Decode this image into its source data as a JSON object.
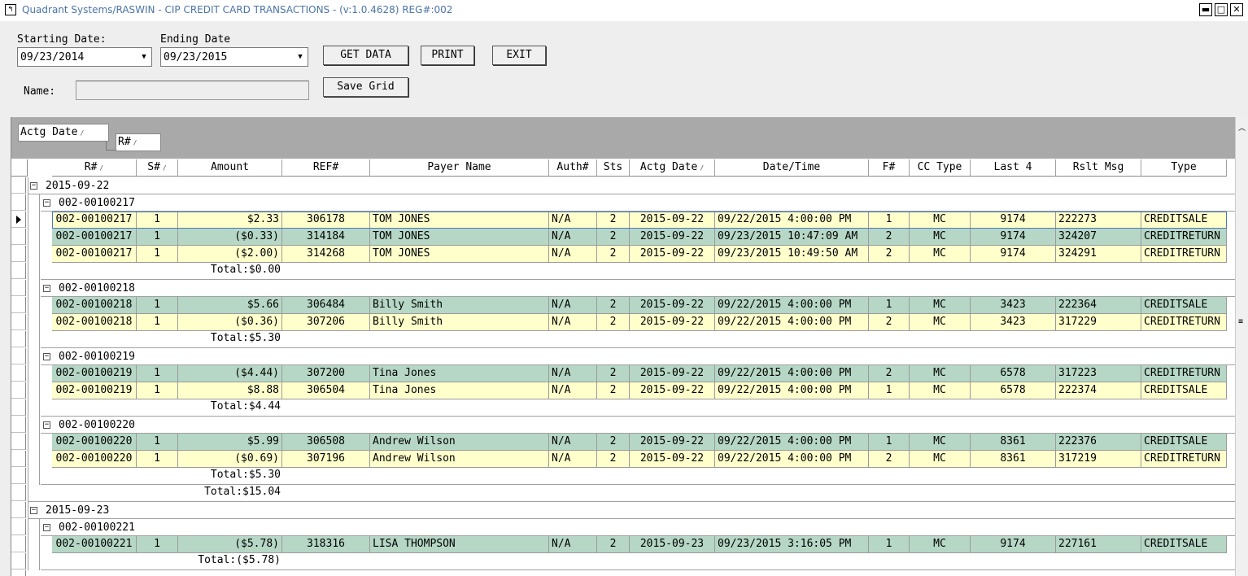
{
  "window": {
    "title": "Quadrant Systems/RASWIN - CIP CREDIT CARD TRANSACTIONS - (v:1.0.4628) REG#:002",
    "icon": "app-icon",
    "minimize": "▬",
    "maximize": "□",
    "close": "✕"
  },
  "form": {
    "start_label": "Starting Date:",
    "start_value": "09/23/2014",
    "end_label": "Ending Date",
    "end_value": "09/23/2015",
    "get_data": "GET DATA",
    "print": "PRINT",
    "exit": "EXIT",
    "name_label": "Name:",
    "name_value": "",
    "save_grid": "Save Grid"
  },
  "grid": {
    "group_chips": [
      {
        "label": "Actg Date"
      },
      {
        "label": "R#"
      }
    ],
    "columns": [
      "R#",
      "S#",
      "Amount",
      "REF#",
      "Payer Name",
      "Auth#",
      "Sts",
      "Actg Date",
      "Date/Time",
      "F#",
      "CC Type",
      "Last 4",
      "Rslt Msg",
      "Type"
    ],
    "date_groups": [
      {
        "date": "2015-09-22",
        "total": "Total:$15.04",
        "subgroups": [
          {
            "r": "002-00100217",
            "total": "Total:$0.00",
            "rows": [
              [
                "002-00100217",
                "1",
                "$2.33",
                "306178",
                "TOM JONES",
                "N/A",
                "2",
                "2015-09-22",
                "09/22/2015 4:00:00 PM",
                "1",
                "MC",
                "9174",
                "222273",
                "CREDITSALE"
              ],
              [
                "002-00100217",
                "1",
                "($0.33)",
                "314184",
                "TOM JONES",
                "N/A",
                "2",
                "2015-09-22",
                "09/23/2015 10:47:09 AM",
                "2",
                "MC",
                "9174",
                "324207",
                "CREDITRETURN"
              ],
              [
                "002-00100217",
                "1",
                "($2.00)",
                "314268",
                "TOM JONES",
                "N/A",
                "2",
                "2015-09-22",
                "09/23/2015 10:49:50 AM",
                "2",
                "MC",
                "9174",
                "324291",
                "CREDITRETURN"
              ]
            ]
          },
          {
            "r": "002-00100218",
            "total": "Total:$5.30",
            "rows": [
              [
                "002-00100218",
                "1",
                "$5.66",
                "306484",
                "Billy Smith",
                "N/A",
                "2",
                "2015-09-22",
                "09/22/2015 4:00:00 PM",
                "1",
                "MC",
                "3423",
                "222364",
                "CREDITSALE"
              ],
              [
                "002-00100218",
                "1",
                "($0.36)",
                "307206",
                "Billy Smith",
                "N/A",
                "2",
                "2015-09-22",
                "09/22/2015 4:00:00 PM",
                "2",
                "MC",
                "3423",
                "317229",
                "CREDITRETURN"
              ]
            ]
          },
          {
            "r": "002-00100219",
            "total": "Total:$4.44",
            "rows": [
              [
                "002-00100219",
                "1",
                "($4.44)",
                "307200",
                "Tina Jones",
                "N/A",
                "2",
                "2015-09-22",
                "09/22/2015 4:00:00 PM",
                "2",
                "MC",
                "6578",
                "317223",
                "CREDITRETURN"
              ],
              [
                "002-00100219",
                "1",
                "$8.88",
                "306504",
                "Tina Jones",
                "N/A",
                "2",
                "2015-09-22",
                "09/22/2015 4:00:00 PM",
                "1",
                "MC",
                "6578",
                "222374",
                "CREDITSALE"
              ]
            ]
          },
          {
            "r": "002-00100220",
            "total": "Total:$5.30",
            "rows": [
              [
                "002-00100220",
                "1",
                "$5.99",
                "306508",
                "Andrew Wilson",
                "N/A",
                "2",
                "2015-09-22",
                "09/22/2015 4:00:00 PM",
                "1",
                "MC",
                "8361",
                "222376",
                "CREDITSALE"
              ],
              [
                "002-00100220",
                "1",
                "($0.69)",
                "307196",
                "Andrew Wilson",
                "N/A",
                "2",
                "2015-09-22",
                "09/22/2015 4:00:00 PM",
                "2",
                "MC",
                "8361",
                "317219",
                "CREDITRETURN"
              ]
            ]
          }
        ]
      },
      {
        "date": "2015-09-23",
        "total": "",
        "subgroups": [
          {
            "r": "002-00100221",
            "total": "Total:($5.78)",
            "rows": [
              [
                "002-00100221",
                "1",
                "($5.78)",
                "318316",
                "LISA THOMPSON",
                "N/A",
                "2",
                "2015-09-23",
                "09/23/2015 3:16:05 PM",
                "1",
                "MC",
                "9174",
                "227161",
                "CREDITSALE"
              ]
            ]
          }
        ]
      }
    ]
  },
  "colors": {
    "row_yellow": "#ffffcc",
    "row_green": "#b6d7c6",
    "group_panel": "#a9a9a9"
  }
}
